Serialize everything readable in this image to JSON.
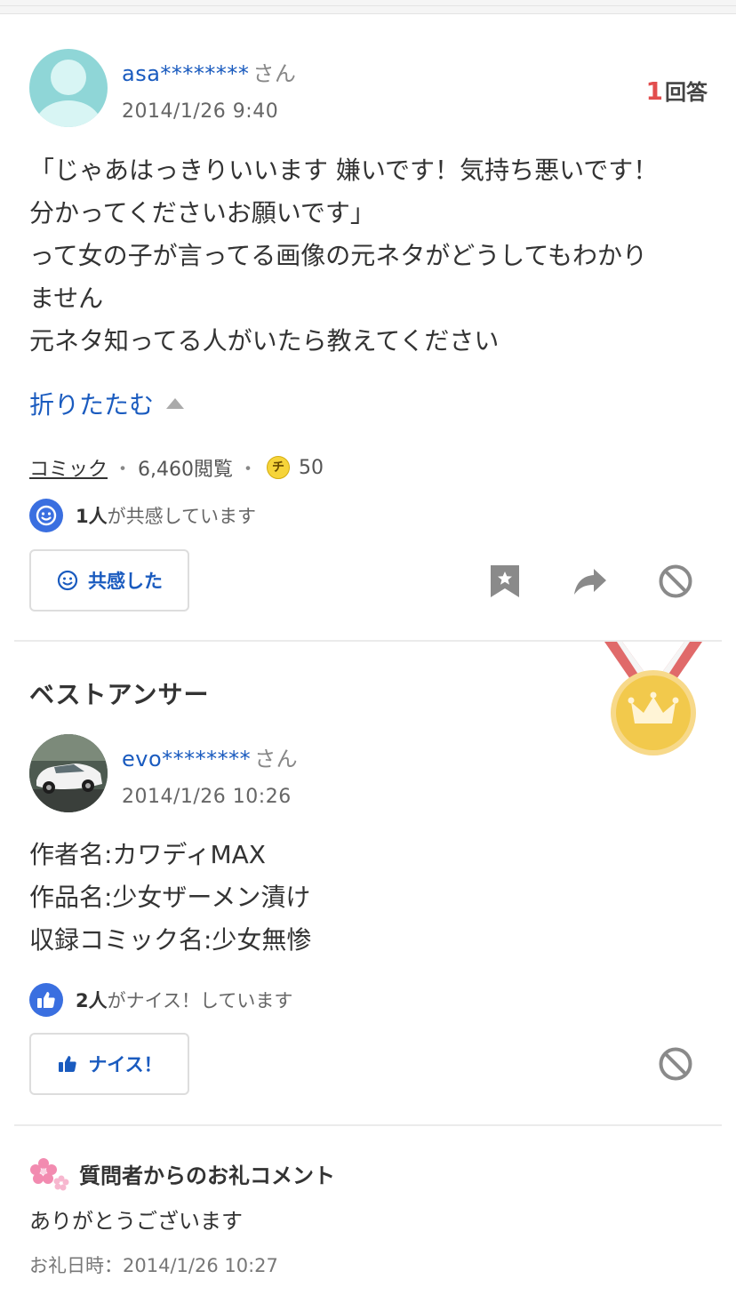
{
  "question": {
    "user_name": "asa********",
    "user_suffix": "さん",
    "date": "2014/1/26 9:40",
    "answer_count_num": "1",
    "answer_count_label": "回答",
    "body_lines": [
      "「じゃあはっきりいいます 嫌いです！気持ち悪いです！",
      "分かってくださいお願いです」",
      "って女の子が言ってる画像の元ネタがどうしてもわかり",
      "ません",
      "元ネタ知ってる人がいたら教えてください"
    ],
    "fold_label": "折りたたむ",
    "category": "コミック",
    "views": "6,460閲覧",
    "coin_glyph": "チ",
    "coins": "50",
    "empathy_count": "1人",
    "empathy_text": "が共感しています",
    "empathy_button": "共感した"
  },
  "best_answer": {
    "title": "ベストアンサー",
    "user_name": "evo********",
    "user_suffix": "さん",
    "date": "2014/1/26 10:26",
    "body_lines": [
      "作者名:カワディMAX",
      "作品名:少女ザーメン漬け",
      "収録コミック名:少女無惨"
    ],
    "nice_count": "2人",
    "nice_text": "がナイス！しています",
    "nice_button": "ナイス！"
  },
  "thanks": {
    "title": "質問者からのお礼コメント",
    "text": "ありがとうございます",
    "date_label": "お礼日時：2014/1/26 10:27"
  },
  "colors": {
    "link": "#1a5bbf",
    "accent_red": "#e24e4e",
    "reaction_blue": "#3a6fe0",
    "medal_gold": "#f2c94c",
    "ribbon_red": "#e06a6a"
  },
  "icons": [
    "bookmark-icon",
    "share-icon",
    "block-icon",
    "smile-icon",
    "thumbs-up-icon",
    "medal-icon",
    "sakura-icon"
  ]
}
